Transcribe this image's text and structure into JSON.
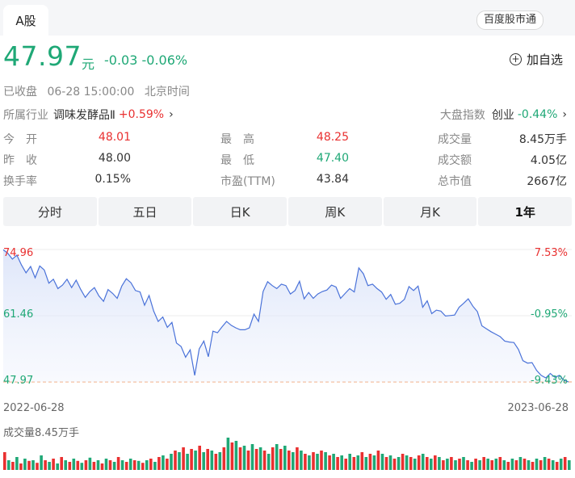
{
  "header": {
    "tab_label": "A股",
    "connect_badge": "百度股市通"
  },
  "quote": {
    "price": "47.97",
    "unit": "元",
    "change": "-0.03 -0.06%",
    "add_watch": "加自选"
  },
  "status": {
    "state": "已收盘",
    "datetime": "06-28 15:00:00",
    "timezone": "北京时间"
  },
  "industry": {
    "label": "所属行业",
    "name": "调味发酵品Ⅱ",
    "change": "+0.59%"
  },
  "market_index": {
    "label": "大盘指数",
    "name": "创业",
    "change": "-0.44%"
  },
  "stats": [
    {
      "label": "今　开",
      "value": "48.01",
      "tone": "red"
    },
    {
      "label": "最　高",
      "value": "48.25",
      "tone": "red"
    },
    {
      "label": "成交量",
      "value": "8.45万手",
      "tone": "neutral"
    },
    {
      "label": "昨　收",
      "value": "48.00",
      "tone": "neutral"
    },
    {
      "label": "最　低",
      "value": "47.40",
      "tone": "green"
    },
    {
      "label": "成交额",
      "value": "4.05亿",
      "tone": "neutral"
    },
    {
      "label": "换手率",
      "value": "0.15%",
      "tone": "neutral"
    },
    {
      "label": "市盈(TTM)",
      "value": "43.84",
      "tone": "neutral"
    },
    {
      "label": "总市值",
      "value": "2667亿",
      "tone": "neutral"
    }
  ],
  "period_tabs": [
    "分时",
    "五日",
    "日K",
    "周K",
    "月K",
    "1年"
  ],
  "active_tab": "1年",
  "colors": {
    "up": "#e93030",
    "down": "#1fa876",
    "line": "#4a72d9"
  },
  "chart_data": {
    "type": "line",
    "x_start": "2022-06-28",
    "x_end": "2023-06-28",
    "y_max": 74.96,
    "y_mid": 61.46,
    "y_min": 47.97,
    "pct_max": "7.53%",
    "pct_mid": "-0.95%",
    "pct_min": "-9.43%",
    "ylim": [
      47.97,
      74.96
    ],
    "values": [
      74.9,
      74.2,
      73.0,
      73.8,
      71.8,
      70.2,
      71.5,
      69.2,
      71.6,
      70.8,
      68.1,
      68.9,
      67.0,
      67.7,
      68.9,
      67.2,
      68.7,
      66.8,
      65.2,
      66.4,
      67.2,
      65.5,
      64.4,
      66.8,
      66.0,
      65.0,
      67.5,
      69.0,
      68.2,
      66.6,
      66.3,
      63.6,
      65.6,
      62.4,
      60.3,
      61.2,
      59.1,
      60.1,
      55.9,
      55.2,
      53.0,
      54.5,
      49.3,
      54.7,
      56.3,
      53.1,
      58.3,
      58.0,
      59.2,
      60.3,
      59.5,
      59.0,
      58.6,
      58.6,
      59.0,
      61.8,
      60.3,
      66.4,
      68.4,
      67.6,
      67.0,
      67.9,
      67.6,
      65.9,
      66.6,
      68.5,
      64.9,
      66.2,
      65.0,
      65.9,
      66.4,
      66.7,
      67.7,
      67.3,
      65.0,
      66.0,
      67.0,
      66.3,
      71.2,
      70.0,
      67.6,
      67.9,
      67.0,
      66.3,
      64.8,
      65.8,
      63.8,
      64.0,
      64.8,
      67.4,
      66.6,
      67.5,
      63.2,
      64.5,
      61.9,
      62.6,
      62.4,
      61.4,
      61.5,
      61.6,
      63.2,
      64.0,
      64.9,
      63.4,
      62.3,
      59.4,
      58.8,
      58.2,
      57.7,
      57.2,
      56.3,
      56.1,
      56.0,
      54.6,
      52.3,
      51.8,
      51.9,
      50.3,
      49.3,
      48.8,
      49.7,
      48.9,
      49.3,
      48.3,
      47.97
    ],
    "volume_label": "成交量8.45万手",
    "volume": [
      {
        "v": 0.55,
        "up": true
      },
      {
        "v": 0.3,
        "up": false
      },
      {
        "v": 0.25,
        "up": true
      },
      {
        "v": 0.4,
        "up": false
      },
      {
        "v": 0.2,
        "up": true
      },
      {
        "v": 0.35,
        "up": false
      },
      {
        "v": 0.28,
        "up": true
      },
      {
        "v": 0.3,
        "up": false
      },
      {
        "v": 0.22,
        "up": true
      },
      {
        "v": 0.45,
        "up": false
      },
      {
        "v": 0.3,
        "up": true
      },
      {
        "v": 0.25,
        "up": false
      },
      {
        "v": 0.35,
        "up": true
      },
      {
        "v": 0.2,
        "up": false
      },
      {
        "v": 0.4,
        "up": true
      },
      {
        "v": 0.3,
        "up": false
      },
      {
        "v": 0.25,
        "up": true
      },
      {
        "v": 0.35,
        "up": false
      },
      {
        "v": 0.28,
        "up": true
      },
      {
        "v": 0.22,
        "up": false
      },
      {
        "v": 0.3,
        "up": true
      },
      {
        "v": 0.38,
        "up": false
      },
      {
        "v": 0.25,
        "up": true
      },
      {
        "v": 0.3,
        "up": false
      },
      {
        "v": 0.2,
        "up": true
      },
      {
        "v": 0.35,
        "up": false
      },
      {
        "v": 0.3,
        "up": true
      },
      {
        "v": 0.25,
        "up": false
      },
      {
        "v": 0.4,
        "up": true
      },
      {
        "v": 0.3,
        "up": false
      },
      {
        "v": 0.25,
        "up": true
      },
      {
        "v": 0.35,
        "up": false
      },
      {
        "v": 0.3,
        "up": true
      },
      {
        "v": 0.28,
        "up": false
      },
      {
        "v": 0.22,
        "up": true
      },
      {
        "v": 0.3,
        "up": false
      },
      {
        "v": 0.35,
        "up": true
      },
      {
        "v": 0.25,
        "up": false
      },
      {
        "v": 0.4,
        "up": true
      },
      {
        "v": 0.45,
        "up": false
      },
      {
        "v": 0.35,
        "up": true
      },
      {
        "v": 0.5,
        "up": false
      },
      {
        "v": 0.6,
        "up": true
      },
      {
        "v": 0.55,
        "up": false
      },
      {
        "v": 0.7,
        "up": true
      },
      {
        "v": 0.5,
        "up": false
      },
      {
        "v": 0.65,
        "up": true
      },
      {
        "v": 0.6,
        "up": false
      },
      {
        "v": 0.75,
        "up": true
      },
      {
        "v": 0.55,
        "up": false
      },
      {
        "v": 0.65,
        "up": true
      },
      {
        "v": 0.6,
        "up": false
      },
      {
        "v": 0.5,
        "up": true
      },
      {
        "v": 0.55,
        "up": false
      },
      {
        "v": 0.7,
        "up": true
      },
      {
        "v": 1.0,
        "up": false
      },
      {
        "v": 0.85,
        "up": true
      },
      {
        "v": 0.9,
        "up": false
      },
      {
        "v": 0.7,
        "up": true
      },
      {
        "v": 0.75,
        "up": false
      },
      {
        "v": 0.6,
        "up": true
      },
      {
        "v": 0.8,
        "up": false
      },
      {
        "v": 0.65,
        "up": true
      },
      {
        "v": 0.7,
        "up": false
      },
      {
        "v": 0.6,
        "up": true
      },
      {
        "v": 0.5,
        "up": false
      },
      {
        "v": 0.7,
        "up": true
      },
      {
        "v": 0.8,
        "up": false
      },
      {
        "v": 0.65,
        "up": true
      },
      {
        "v": 0.75,
        "up": false
      },
      {
        "v": 0.6,
        "up": true
      },
      {
        "v": 0.55,
        "up": false
      },
      {
        "v": 0.7,
        "up": true
      },
      {
        "v": 0.6,
        "up": false
      },
      {
        "v": 0.5,
        "up": true
      },
      {
        "v": 0.45,
        "up": false
      },
      {
        "v": 0.55,
        "up": true
      },
      {
        "v": 0.5,
        "up": false
      },
      {
        "v": 0.6,
        "up": true
      },
      {
        "v": 0.55,
        "up": false
      },
      {
        "v": 0.45,
        "up": true
      },
      {
        "v": 0.5,
        "up": false
      },
      {
        "v": 0.4,
        "up": true
      },
      {
        "v": 0.45,
        "up": false
      },
      {
        "v": 0.35,
        "up": true
      },
      {
        "v": 0.5,
        "up": false
      },
      {
        "v": 0.4,
        "up": true
      },
      {
        "v": 0.45,
        "up": false
      },
      {
        "v": 0.55,
        "up": true
      },
      {
        "v": 0.4,
        "up": false
      },
      {
        "v": 0.5,
        "up": true
      },
      {
        "v": 0.45,
        "up": false
      },
      {
        "v": 0.6,
        "up": true
      },
      {
        "v": 0.5,
        "up": false
      },
      {
        "v": 0.4,
        "up": true
      },
      {
        "v": 0.45,
        "up": false
      },
      {
        "v": 0.35,
        "up": true
      },
      {
        "v": 0.4,
        "up": false
      },
      {
        "v": 0.5,
        "up": true
      },
      {
        "v": 0.45,
        "up": false
      },
      {
        "v": 0.4,
        "up": true
      },
      {
        "v": 0.35,
        "up": false
      },
      {
        "v": 0.45,
        "up": true
      },
      {
        "v": 0.5,
        "up": false
      },
      {
        "v": 0.4,
        "up": true
      },
      {
        "v": 0.35,
        "up": false
      },
      {
        "v": 0.45,
        "up": true
      },
      {
        "v": 0.4,
        "up": false
      },
      {
        "v": 0.3,
        "up": true
      },
      {
        "v": 0.35,
        "up": false
      },
      {
        "v": 0.4,
        "up": true
      },
      {
        "v": 0.3,
        "up": false
      },
      {
        "v": 0.35,
        "up": true
      },
      {
        "v": 0.4,
        "up": false
      },
      {
        "v": 0.3,
        "up": true
      },
      {
        "v": 0.25,
        "up": false
      },
      {
        "v": 0.35,
        "up": true
      },
      {
        "v": 0.3,
        "up": false
      },
      {
        "v": 0.4,
        "up": true
      },
      {
        "v": 0.35,
        "up": false
      },
      {
        "v": 0.3,
        "up": true
      },
      {
        "v": 0.35,
        "up": false
      },
      {
        "v": 0.4,
        "up": true
      },
      {
        "v": 0.3,
        "up": false
      },
      {
        "v": 0.25,
        "up": true
      },
      {
        "v": 0.35,
        "up": false
      },
      {
        "v": 0.3,
        "up": true
      },
      {
        "v": 0.4,
        "up": false
      },
      {
        "v": 0.35,
        "up": true
      },
      {
        "v": 0.3,
        "up": false
      },
      {
        "v": 0.25,
        "up": true
      },
      {
        "v": 0.35,
        "up": false
      },
      {
        "v": 0.3,
        "up": true
      },
      {
        "v": 0.4,
        "up": false
      },
      {
        "v": 0.35,
        "up": true
      },
      {
        "v": 0.3,
        "up": false
      },
      {
        "v": 0.25,
        "up": true
      },
      {
        "v": 0.35,
        "up": false
      },
      {
        "v": 0.4,
        "up": true
      },
      {
        "v": 0.3,
        "up": false
      }
    ]
  }
}
